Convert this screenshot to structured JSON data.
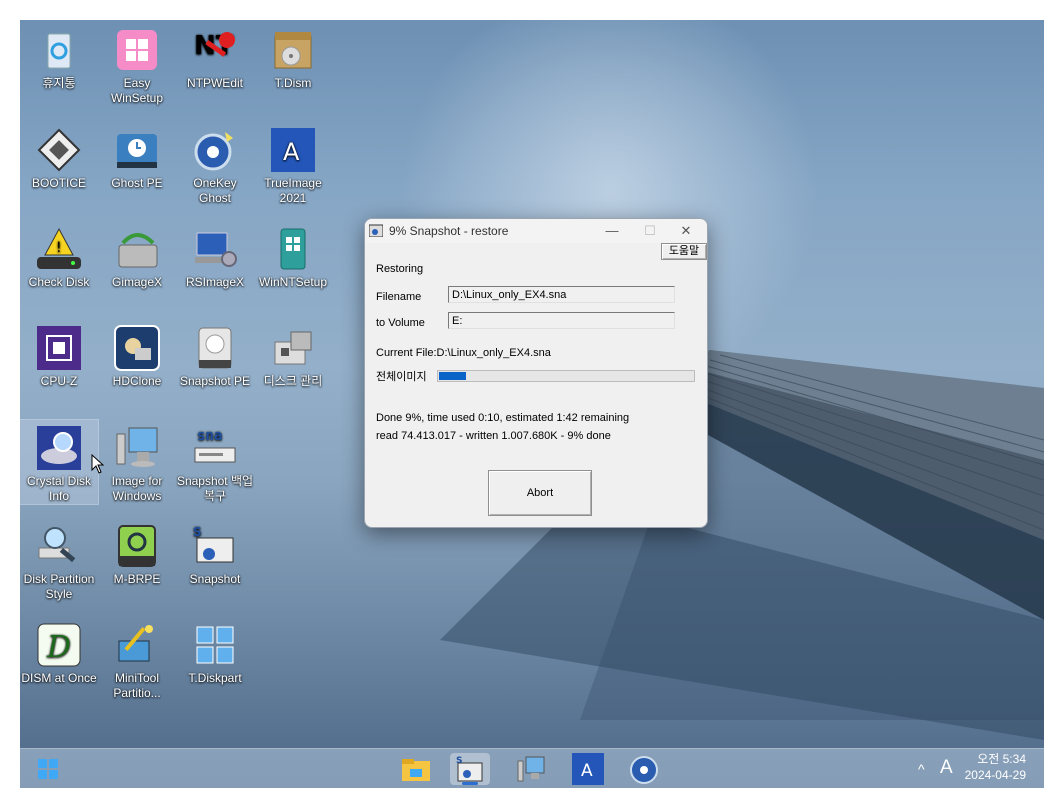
{
  "desktop": {
    "icons": [
      {
        "label": "휴지통"
      },
      {
        "label": "Easy WinSetup"
      },
      {
        "label": "NTPWEdit"
      },
      {
        "label": "T.Dism"
      },
      {
        "label": "BOOTICE"
      },
      {
        "label": "Ghost PE"
      },
      {
        "label": "OneKey Ghost"
      },
      {
        "label": "TrueImage 2021"
      },
      {
        "label": "Check Disk"
      },
      {
        "label": "GimageX"
      },
      {
        "label": "RSImageX"
      },
      {
        "label": "WinNTSetup"
      },
      {
        "label": "CPU-Z"
      },
      {
        "label": "HDClone"
      },
      {
        "label": "Snapshot PE"
      },
      {
        "label": "디스크 관리"
      },
      {
        "label": "Crystal Disk Info"
      },
      {
        "label": "Image for Windows"
      },
      {
        "label": "Snapshot 백업 복구"
      },
      {
        "label": "Disk Partition Style"
      },
      {
        "label": "M-BRPE"
      },
      {
        "label": "Snapshot"
      },
      {
        "label": "DISM at Once"
      },
      {
        "label": "MiniTool Partitio..."
      },
      {
        "label": "T.Diskpart"
      }
    ]
  },
  "dialog": {
    "title": "9% Snapshot - restore",
    "help_label": "도움말",
    "status": "Restoring",
    "filename_label": "Filename",
    "filename_value": "D:\\Linux_only_EX4.sna",
    "volume_label": "to Volume",
    "volume_value": "E:",
    "current_file": "Current File:D:\\Linux_only_EX4.sna",
    "image_label": "전체이미지",
    "progress": 0.09,
    "progress_color": "#0a64c8",
    "done_line": "Done 9%, time used  0:10, estimated 1:42 remaining",
    "read_line": "read   74.413.017 - written   1.007.680K - 9% done",
    "abort_label": "Abort",
    "minimize_glyph": "—",
    "maximize_glyph": "☐",
    "close_glyph": "✕"
  },
  "taskbar": {
    "tray_chevron": "^",
    "ime_indicator": "A",
    "time": "오전 5:34",
    "date": "2024-04-29"
  }
}
